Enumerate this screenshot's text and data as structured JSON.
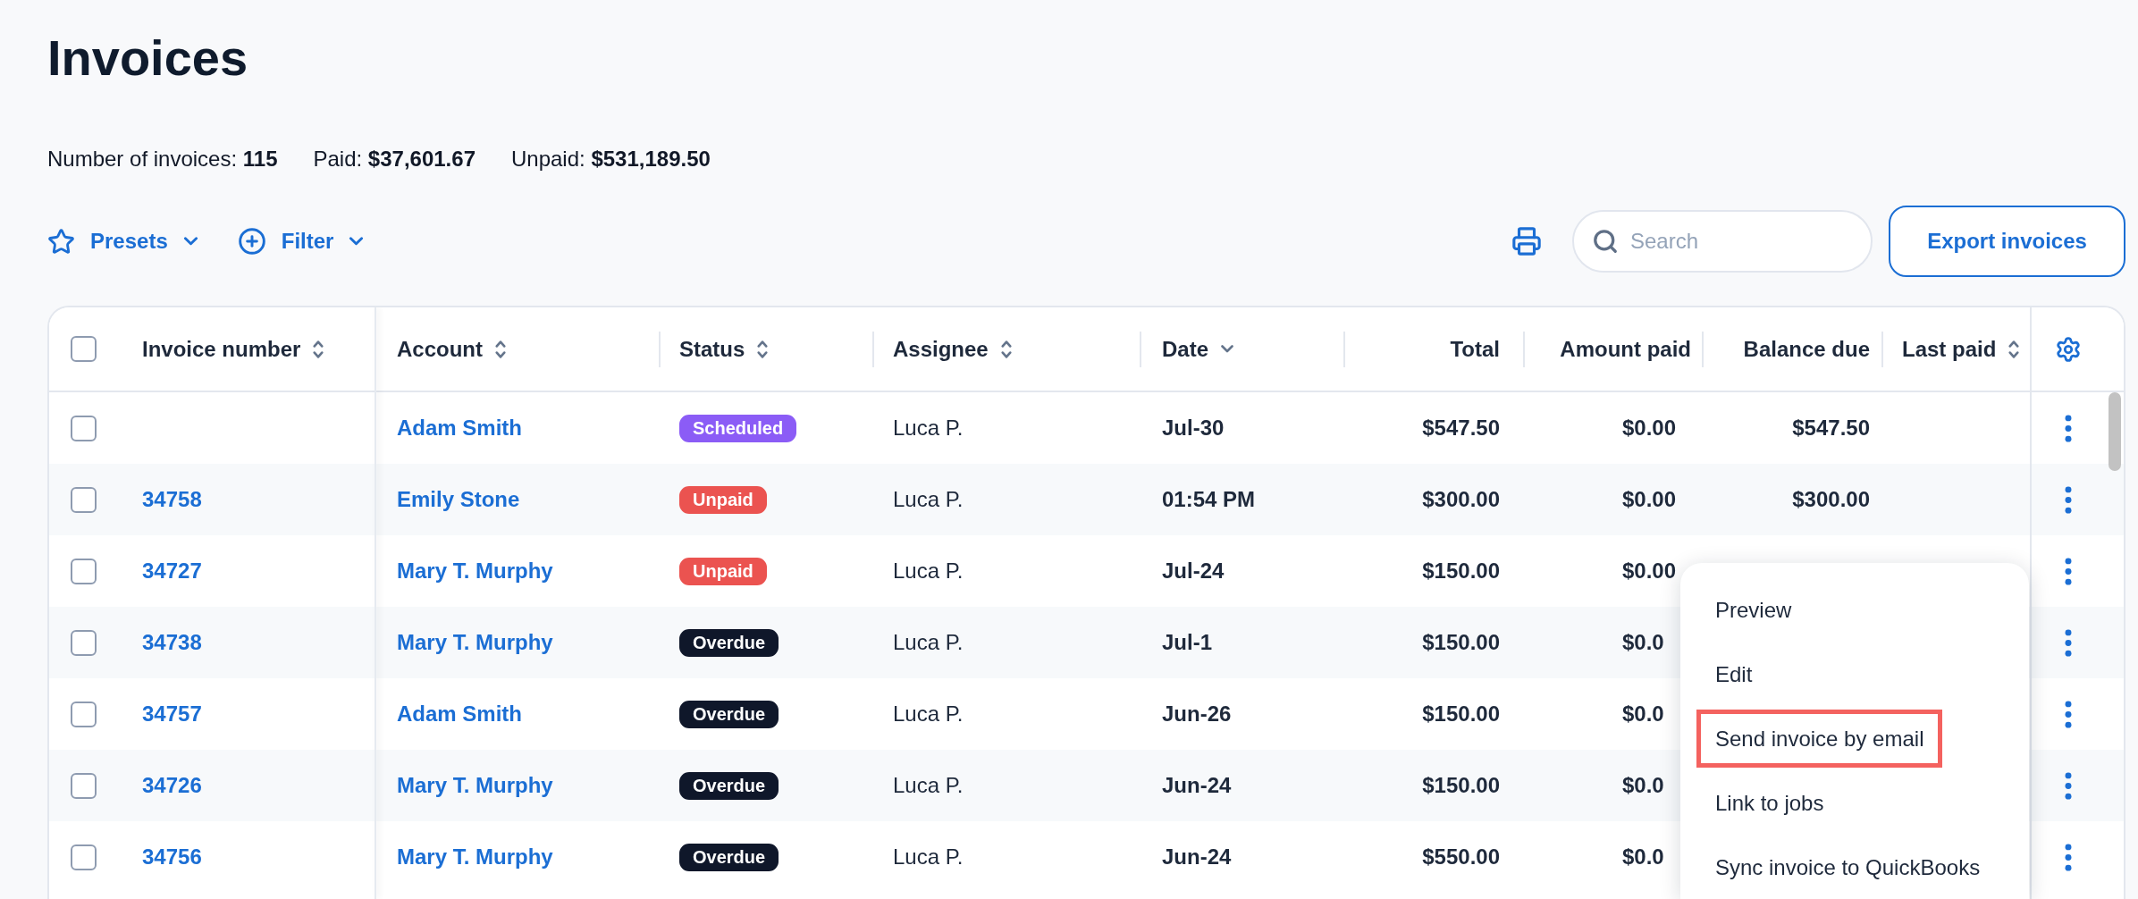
{
  "page": {
    "title": "Invoices"
  },
  "summary": [
    {
      "text": "Number of invoices: **115**"
    },
    {
      "text": "Paid: **$37,601.67**"
    },
    {
      "text": "Unpaid: **$531,189.50**"
    }
  ],
  "toolbar": {
    "presets": {
      "label": "Presets"
    },
    "filter": {
      "label": "Filter"
    },
    "search": {
      "placeholder": "Search"
    },
    "export_button": {
      "label": "Export invoices"
    }
  },
  "table": {
    "select_all": {
      "checked": false
    },
    "columns": [
      {
        "label": "Invoice number",
        "sortable": true,
        "sorted": false
      },
      {
        "label": "Account",
        "sortable": true,
        "sorted": false
      },
      {
        "label": "Status",
        "sortable": true,
        "sorted": false
      },
      {
        "label": "Assignee",
        "sortable": true,
        "sorted": false
      },
      {
        "label": "Date",
        "sortable": true,
        "sorted": true
      },
      {
        "label": "Total",
        "sortable": false,
        "sorted": false
      },
      {
        "label": "Amount paid",
        "sortable": false,
        "sorted": false
      },
      {
        "label": "Balance due",
        "sortable": false,
        "sorted": false
      },
      {
        "label": "Last paid",
        "sortable": true,
        "sorted": false
      }
    ],
    "rows": [
      {
        "checked": false,
        "account": "Adam Smith",
        "status": {
          "label": "Scheduled",
          "color": "#8b5cf6"
        },
        "assignee": "Luca P.",
        "date": "Jul-30",
        "total": "$547.50",
        "amount_paid": "$0.00",
        "balance_due": "$547.50"
      },
      {
        "checked": false,
        "invoice_number": "34758",
        "account": "Emily Stone",
        "status": {
          "label": "Unpaid",
          "color": "#eb5350"
        },
        "assignee": "Luca P.",
        "date": "01:54 PM",
        "total": "$300.00",
        "amount_paid": "$0.00",
        "balance_due": "$300.00"
      },
      {
        "checked": false,
        "invoice_number": "34727",
        "account": "Mary T. Murphy",
        "status": {
          "label": "Unpaid",
          "color": "#eb5350"
        },
        "assignee": "Luca P.",
        "date": "Jul-24",
        "total": "$150.00",
        "amount_paid": "$0.00"
      },
      {
        "checked": false,
        "invoice_number": "34738",
        "account": "Mary T. Murphy",
        "status": {
          "label": "Overdue",
          "color": "#0f172a"
        },
        "assignee": "Luca P.",
        "date": "Jul-1",
        "total": "$150.00",
        "amount_paid": "$0.0"
      },
      {
        "checked": false,
        "invoice_number": "34757",
        "account": "Adam Smith",
        "status": {
          "label": "Overdue",
          "color": "#0f172a"
        },
        "assignee": "Luca P.",
        "date": "Jun-26",
        "total": "$150.00",
        "amount_paid": "$0.0"
      },
      {
        "checked": false,
        "invoice_number": "34726",
        "account": "Mary T. Murphy",
        "status": {
          "label": "Overdue",
          "color": "#0f172a"
        },
        "assignee": "Luca P.",
        "date": "Jun-24",
        "total": "$150.00",
        "amount_paid": "$0.0"
      },
      {
        "checked": false,
        "invoice_number": "34756",
        "account": "Mary T. Murphy",
        "status": {
          "label": "Overdue",
          "color": "#0f172a"
        },
        "assignee": "Luca P.",
        "date": "Jun-24",
        "total": "$550.00",
        "amount_paid": "$0.0"
      }
    ]
  },
  "row_menu": {
    "items": [
      {
        "label": "Preview",
        "highlighted": false
      },
      {
        "label": "Edit",
        "highlighted": false
      },
      {
        "label": "Send invoice by email",
        "highlighted": true
      },
      {
        "label": "Link to jobs",
        "highlighted": false
      },
      {
        "label": "Sync invoice to QuickBooks",
        "highlighted": false
      }
    ]
  }
}
